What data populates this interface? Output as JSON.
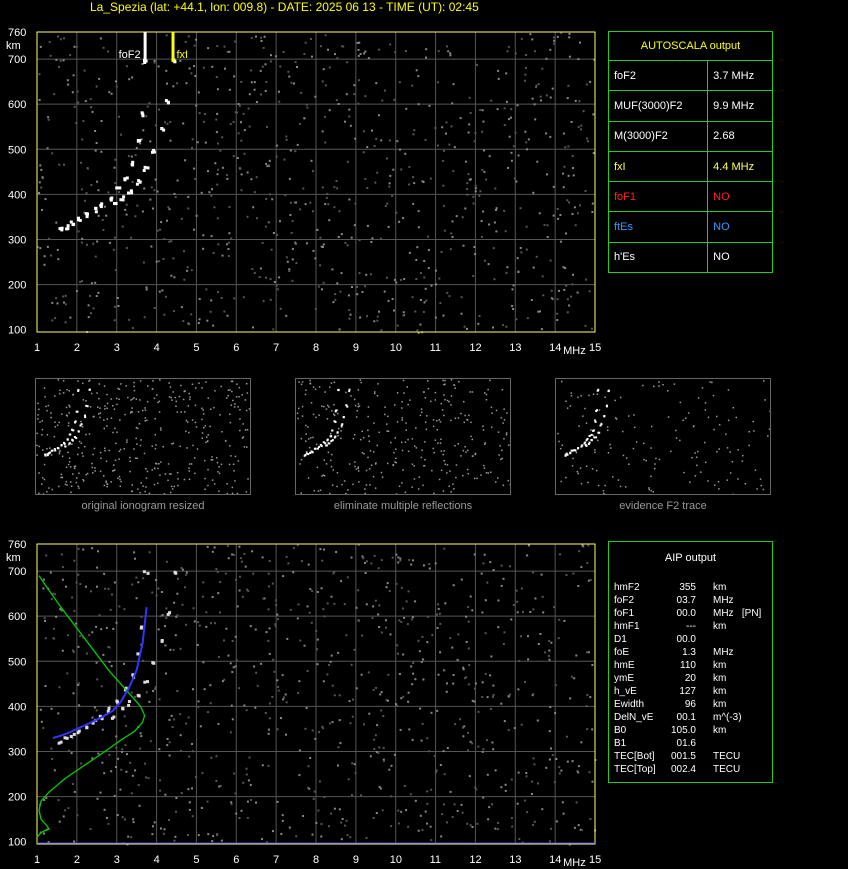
{
  "header": {
    "title": "La_Spezia (lat: +44.1, lon: 009.8) - DATE: 2025 06 13 - TIME (UT): 02:45"
  },
  "colors": {
    "grid": "#555555",
    "axis": "#ffff66",
    "panel_border": "#22cc22",
    "foF2_marker": "#ffffff",
    "fxI_marker": "#ffff00",
    "profile": "#00cc00",
    "trace_fit": "#3333ff",
    "foF1_value": "#ff2222",
    "ftEs_value": "#3399ff"
  },
  "top_chart": {
    "y_unit": "km",
    "x_unit": "MHz",
    "marker_labels": {
      "foF2": "foF2",
      "fxI": "fxI"
    }
  },
  "bottom_chart": {
    "y_unit": "km",
    "x_unit": "MHz"
  },
  "autoscala": {
    "title": "AUTOSCALA output",
    "rows": [
      {
        "label": "foF2",
        "value": "3.7 MHz",
        "label_color": "#ffffff",
        "value_color": "#ffffff"
      },
      {
        "label": "MUF(3000)F2",
        "value": "9.9 MHz",
        "label_color": "#ffffff",
        "value_color": "#ffffff"
      },
      {
        "label": "M(3000)F2",
        "value": "2.68",
        "label_color": "#ffffff",
        "value_color": "#ffffff"
      },
      {
        "label": "fxI",
        "value": "4.4 MHz",
        "label_color": "#ffff66",
        "value_color": "#ffff66"
      },
      {
        "label": "foF1",
        "value": "NO",
        "label_color": "#ff2222",
        "value_color": "#ff2222"
      },
      {
        "label": "ftEs",
        "value": "NO",
        "label_color": "#3399ff",
        "value_color": "#3399ff"
      },
      {
        "label": "h'Es",
        "value": "NO",
        "label_color": "#ffffff",
        "value_color": "#ffffff"
      }
    ]
  },
  "thumbnails": [
    {
      "caption": "original ionogram resized"
    },
    {
      "caption": "eliminate multiple reflections"
    },
    {
      "caption": "evidence F2 trace"
    }
  ],
  "aip": {
    "title": "AIP output",
    "rows": [
      {
        "name": "hmF2",
        "value": "355",
        "unit": "km"
      },
      {
        "name": "foF2",
        "value": "03.7",
        "unit": "MHz"
      },
      {
        "name": "foF1",
        "value": "00.0",
        "unit": "MHz   [PN]"
      },
      {
        "name": "hmF1",
        "value": "---",
        "unit": "km"
      },
      {
        "name": "D1",
        "value": "00.0",
        "unit": ""
      },
      {
        "name": "foE",
        "value": "1.3",
        "unit": "MHz"
      },
      {
        "name": "hmE",
        "value": "110",
        "unit": "km"
      },
      {
        "name": "ymE",
        "value": "20",
        "unit": "km"
      },
      {
        "name": "h_vE",
        "value": "127",
        "unit": "km"
      },
      {
        "name": "Ewidth",
        "value": "96",
        "unit": "km"
      },
      {
        "name": "DelN_vE",
        "value": "00.1",
        "unit": "m^(-3)"
      },
      {
        "name": "B0",
        "value": "105.0",
        "unit": "km"
      },
      {
        "name": "B1",
        "value": "01.6",
        "unit": ""
      },
      {
        "name": "TEC[Bot]",
        "value": "001.5",
        "unit": "TECU"
      },
      {
        "name": "TEC[Top]",
        "value": "002.4",
        "unit": "TECU"
      }
    ]
  },
  "chart_data": [
    {
      "type": "scatter",
      "title": "",
      "xlabel": "MHz",
      "ylabel": "km",
      "xlim": [
        1,
        15
      ],
      "ylim": [
        95,
        760
      ],
      "x_ticks": [
        "1",
        "2",
        "3",
        "4",
        "5",
        "6",
        "7",
        "8",
        "9",
        "10",
        "11",
        "12",
        "13",
        "14",
        "15"
      ],
      "y_ticks": [
        "100",
        "200",
        "300",
        "400",
        "500",
        "600",
        "700",
        "760"
      ],
      "grid": true,
      "markers": [
        {
          "name": "foF2",
          "x": 3.7
        },
        {
          "name": "fxI",
          "x": 4.4
        }
      ],
      "series": [
        {
          "name": "",
          "x": [
            1.55,
            1.7,
            1.85,
            2.0,
            2.2,
            2.4,
            2.6,
            2.8,
            3.0,
            3.2,
            3.35,
            3.5,
            3.6,
            3.7
          ],
          "y": [
            325,
            330,
            338,
            347,
            358,
            368,
            380,
            395,
            415,
            440,
            470,
            520,
            580,
            700
          ]
        },
        {
          "name": "",
          "x": [
            2.9,
            3.1,
            3.3,
            3.5,
            3.7,
            3.9,
            4.1,
            4.25,
            4.4
          ],
          "y": [
            380,
            395,
            410,
            430,
            460,
            500,
            550,
            610,
            700
          ]
        }
      ]
    },
    {
      "type": "line",
      "title": "",
      "xlabel": "MHz",
      "ylabel": "km",
      "xlim": [
        1,
        15
      ],
      "ylim": [
        95,
        760
      ],
      "x_ticks": [
        "1",
        "2",
        "3",
        "4",
        "5",
        "6",
        "7",
        "8",
        "9",
        "10",
        "11",
        "12",
        "13",
        "14",
        "15"
      ],
      "y_ticks": [
        "100",
        "200",
        "300",
        "400",
        "500",
        "600",
        "700",
        "760"
      ],
      "grid": true,
      "series": [
        {
          "name": "",
          "x": [
            1.0,
            1.1,
            1.2,
            1.3,
            1.25,
            1.1,
            1.05,
            1.1,
            1.3,
            1.7,
            2.2,
            2.7,
            3.1,
            3.45,
            3.65,
            3.7,
            3.6,
            3.3,
            2.8,
            2.2,
            1.6,
            1.2,
            1.05
          ],
          "y": [
            110,
            120,
            125,
            128,
            135,
            150,
            170,
            190,
            210,
            240,
            270,
            300,
            325,
            345,
            365,
            380,
            400,
            430,
            480,
            550,
            620,
            670,
            690
          ]
        },
        {
          "name": "",
          "x": [
            1.4,
            1.6,
            1.8,
            2.0,
            2.3,
            2.6,
            2.9,
            3.1,
            3.3,
            3.5,
            3.65,
            3.75
          ],
          "y": [
            330,
            335,
            342,
            350,
            362,
            375,
            390,
            410,
            440,
            480,
            540,
            620
          ]
        }
      ]
    }
  ]
}
